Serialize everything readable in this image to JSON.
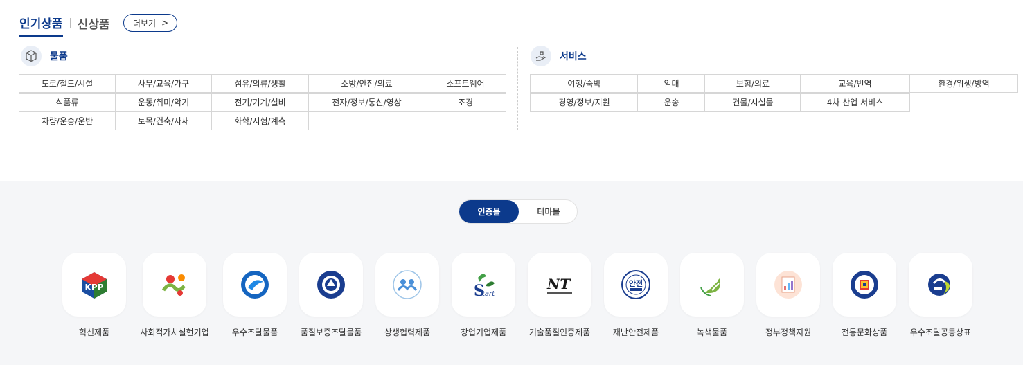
{
  "tabs": {
    "popular": "인기상품",
    "new": "신상품",
    "more": "더보기",
    "more_icon": "chevron-right-icon"
  },
  "goods": {
    "title": "물품",
    "icon": "box-icon",
    "items": [
      "도로/철도/시설",
      "사무/교육/가구",
      "섬유/의류/생활",
      "소방/안전/의료",
      "소프트웨어",
      "식품류",
      "운동/취미/악기",
      "전기/기계/설비",
      "전자/정보/통신/영상",
      "조경",
      "차량/운송/운반",
      "토목/건축/자재",
      "화학/시험/계측"
    ]
  },
  "services": {
    "title": "서비스",
    "icon": "hand-service-icon",
    "items": [
      "여행/숙박",
      "임대",
      "보험/의료",
      "교육/번역",
      "환경/위생/방역",
      "경영/정보/지원",
      "운송",
      "건물/시설물",
      "4차 산업 서비스"
    ]
  },
  "toggle": {
    "active": "인증몰",
    "inactive": "테마몰"
  },
  "certs": [
    {
      "label": "혁신제품",
      "icon": "innovation-product-icon"
    },
    {
      "label": "사회적가치실현기업",
      "icon": "social-value-icon"
    },
    {
      "label": "우수조달물품",
      "icon": "excellent-procurement-icon"
    },
    {
      "label": "품질보증조달물품",
      "icon": "quality-assurance-icon"
    },
    {
      "label": "상생협력제품",
      "icon": "win-win-cooperation-icon"
    },
    {
      "label": "창업기업제품",
      "icon": "startup-icon"
    },
    {
      "label": "기술품질인증제품",
      "icon": "net-certification-icon"
    },
    {
      "label": "재난안전제품",
      "icon": "disaster-safety-icon"
    },
    {
      "label": "녹색물품",
      "icon": "green-certification-icon"
    },
    {
      "label": "정부정책지원",
      "icon": "policy-support-icon"
    },
    {
      "label": "전통문화상품",
      "icon": "traditional-culture-icon"
    },
    {
      "label": "우수조달공동상표",
      "icon": "joint-brand-icon"
    }
  ]
}
